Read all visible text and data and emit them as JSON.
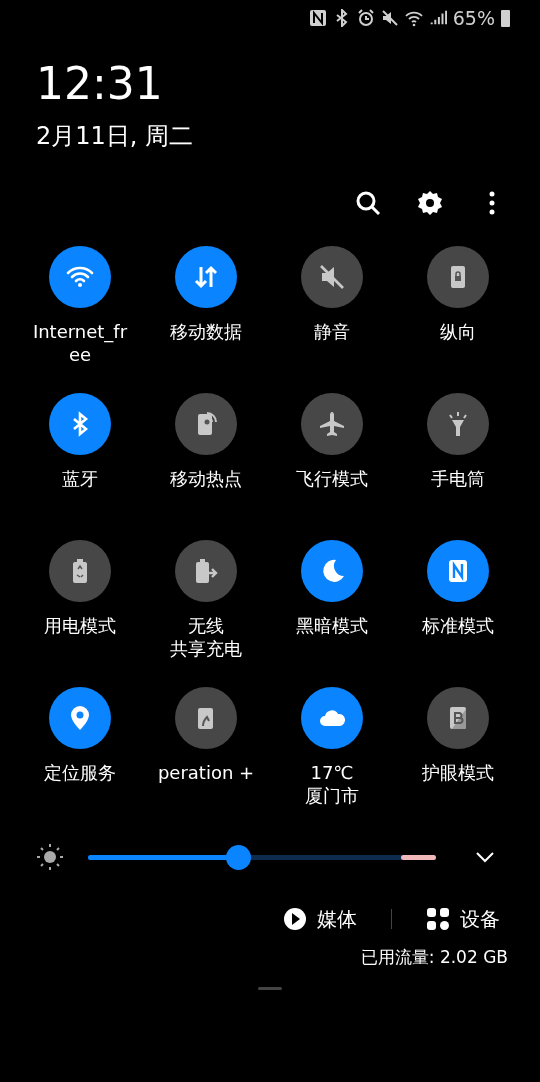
{
  "status_bar": {
    "battery_text": "65%"
  },
  "header": {
    "time": "12:31",
    "date": "2月11日, 周二"
  },
  "tiles": [
    {
      "on": true,
      "lines": [
        "Internet_fr",
        "ee"
      ]
    },
    {
      "on": true,
      "lines": [
        "移动数据"
      ]
    },
    {
      "on": false,
      "lines": [
        "静音"
      ]
    },
    {
      "on": false,
      "lines": [
        "纵向"
      ]
    },
    {
      "on": true,
      "lines": [
        "蓝牙"
      ]
    },
    {
      "on": false,
      "lines": [
        "移动热点"
      ]
    },
    {
      "on": false,
      "lines": [
        "飞行模式"
      ]
    },
    {
      "on": false,
      "lines": [
        "手电筒"
      ]
    },
    {
      "on": false,
      "lines": [
        "用电模式"
      ]
    },
    {
      "on": false,
      "lines": [
        "无线",
        "共享充电"
      ]
    },
    {
      "on": true,
      "lines": [
        "黑暗模式"
      ]
    },
    {
      "on": true,
      "lines": [
        "标准模式"
      ]
    },
    {
      "on": true,
      "lines": [
        "定位服务"
      ]
    },
    {
      "on": false,
      "lines": [
        "peration +"
      ]
    },
    {
      "on": true,
      "lines": [
        "17℃",
        "厦门市"
      ]
    },
    {
      "on": false,
      "lines": [
        "护眼模式"
      ]
    }
  ],
  "brightness": {
    "level": 0.43
  },
  "bottom": {
    "media": "媒体",
    "devices": "设备",
    "data_usage": "已用流量: 2.02 GB"
  }
}
